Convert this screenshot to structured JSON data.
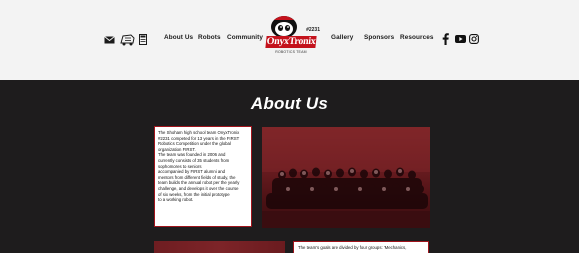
{
  "header": {
    "nav_left": [
      "About Us",
      "Robots",
      "Community"
    ],
    "nav_right": [
      "Gallery",
      "Sponsors",
      "Resources"
    ],
    "logo": {
      "brand": "OnyxTronix",
      "team": "#2231",
      "sub": "ROBOTICS TEAM"
    },
    "icons_left": [
      "mail-icon",
      "robot-icon",
      "document-icon"
    ],
    "icons_right": [
      "facebook-icon",
      "youtube-icon",
      "instagram-icon"
    ]
  },
  "about": {
    "title": "About Us",
    "intro_lines": [
      "The Shoham high school team OnyxTronix",
      "#2231 competed for 13 years in the FIRST",
      "Robotics Competition under the global",
      "organization FIRST.",
      "The team was founded in 2006 and",
      "currently consists of 35 students from",
      "sophomores to seniors",
      "accompanied by FIRST alumni and",
      "mentors from different fields of study, the",
      "team builds the annual robot per the yearly",
      "challenge, and develops it over the course",
      "of six weeks, from the initial prototype",
      "to a working robot."
    ],
    "goals_text": "The team's goals are divided by four groups: 'Mechanics,"
  },
  "colors": {
    "accent": "#a0141c",
    "dark_bg": "#1e1c1d",
    "header_bg": "#f3f3f3"
  }
}
